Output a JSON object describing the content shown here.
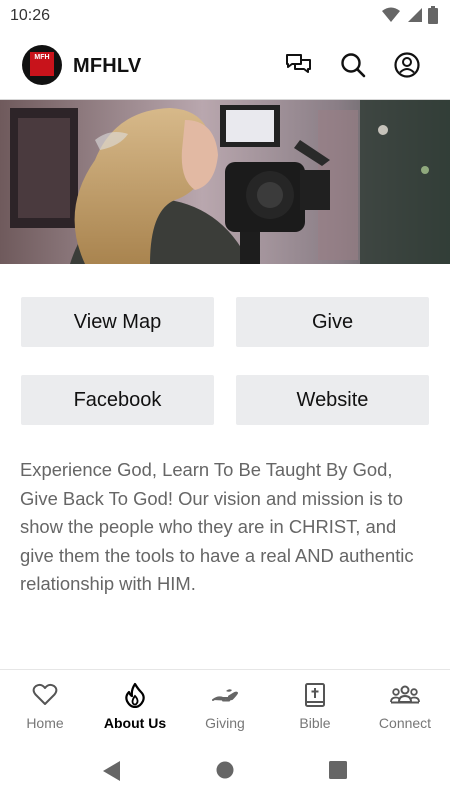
{
  "status": {
    "time": "10:26"
  },
  "header": {
    "title": "MFHLV",
    "logo_text": "MFH"
  },
  "buttons": [
    {
      "label": "View Map"
    },
    {
      "label": "Give"
    },
    {
      "label": "Facebook"
    },
    {
      "label": "Website"
    }
  ],
  "about": {
    "text": "Experience God, Learn To Be Taught By God, Give Back To God!  Our vision and mission is to show the people who they are in CHRIST, and give them the tools to have a real AND authentic relationship with HIM."
  },
  "nav": {
    "active": "About Us",
    "items": [
      {
        "label": "Home",
        "icon": "heart-icon"
      },
      {
        "label": "About Us",
        "icon": "flame-icon"
      },
      {
        "label": "Giving",
        "icon": "giving-hand-icon"
      },
      {
        "label": "Bible",
        "icon": "bible-icon"
      },
      {
        "label": "Connect",
        "icon": "people-icon"
      }
    ]
  },
  "colors": {
    "button_bg": "#ebecee",
    "logo_red": "#c8131b",
    "text_gray": "#666666"
  }
}
